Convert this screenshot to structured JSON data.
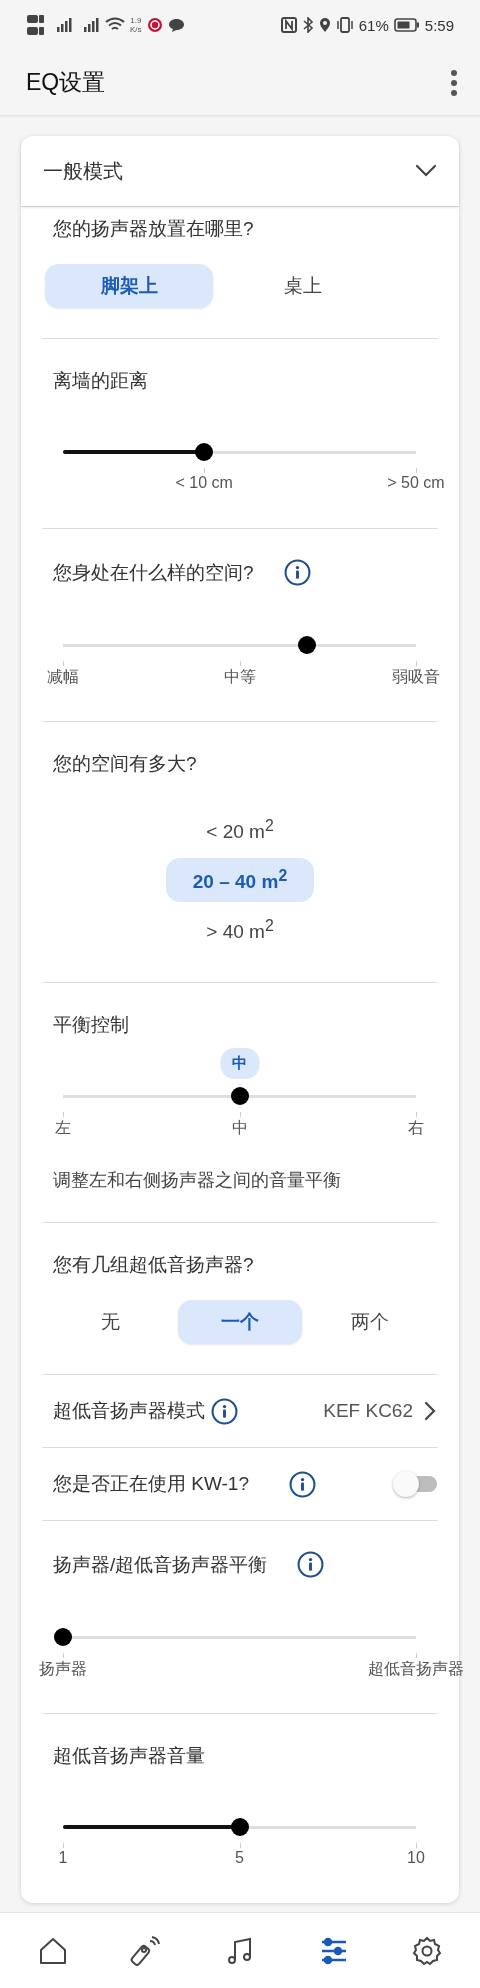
{
  "status_bar": {
    "speed_value": "1.9",
    "speed_unit": "K/s",
    "battery": "61%",
    "time": "5:59"
  },
  "app_bar": {
    "title": "EQ设置"
  },
  "mode": {
    "label": "一般模式"
  },
  "sections": [
    {
      "kind": "segmented",
      "title": "您的扬声器放置在哪里?",
      "options": [
        {
          "label": "脚架上",
          "selected": true
        },
        {
          "label": "桌上",
          "selected": false
        }
      ]
    },
    {
      "kind": "slider",
      "title": "离墙的距离",
      "info": false,
      "fill": true,
      "level": 0.4,
      "labels": [
        {
          "text": "< 10 cm",
          "under_thumb": true
        },
        {
          "text": "> 50 cm",
          "under_thumb": false
        }
      ]
    },
    {
      "kind": "slider",
      "title": "您身处在什么样的空间?",
      "info": true,
      "fill": false,
      "level": 0.69,
      "labels": [
        {
          "text": "减幅",
          "under_thumb": false
        },
        {
          "text": "中等",
          "under_thumb": false
        },
        {
          "text": "弱吸音",
          "under_thumb": false
        }
      ]
    },
    {
      "kind": "list",
      "title": "您的空间有多大?",
      "options": [
        {
          "label": "< 20 m$^{2}$",
          "selected": false
        },
        {
          "label": "20 – 40 m$^{2}$",
          "selected": true
        },
        {
          "label": "> 40 m$^{2}$",
          "selected": false
        }
      ]
    },
    {
      "kind": "slider",
      "title": "平衡控制",
      "info": false,
      "fill": false,
      "level": 0.5,
      "bubble": "中",
      "labels": [
        {
          "text": "左",
          "under_thumb": false
        },
        {
          "text": "中",
          "under_thumb": false
        },
        {
          "text": "右",
          "under_thumb": false
        }
      ],
      "description": "调整左和右侧扬声器之间的音量平衡"
    },
    {
      "kind": "segmented",
      "title": "您有几组超低音扬声器?",
      "options": [
        {
          "label": "无",
          "selected": false
        },
        {
          "label": "一个",
          "selected": true
        },
        {
          "label": "两个",
          "selected": false
        }
      ]
    },
    {
      "kind": "link",
      "title": "超低音扬声器模式",
      "info": true,
      "value": "KEF KC62"
    },
    {
      "kind": "switch",
      "title": "您是否正在使用 KW-1?",
      "info": true,
      "on": false
    },
    {
      "kind": "slider",
      "title": "扬声器/超低音扬声器平衡",
      "info": true,
      "fill": false,
      "level": 0,
      "labels": [
        {
          "text": "扬声器",
          "under_thumb": false
        },
        {
          "text": "超低音扬声器",
          "under_thumb": false
        }
      ]
    },
    {
      "kind": "slider",
      "title": "超低音扬声器音量",
      "info": false,
      "fill": true,
      "level": 0.5,
      "labels": [
        {
          "text": "1",
          "under_thumb": false
        },
        {
          "text": "5",
          "under_thumb": false
        },
        {
          "text": "10",
          "under_thumb": false
        }
      ]
    }
  ],
  "nav": [
    {
      "kind": "home",
      "selected": false
    },
    {
      "kind": "remote",
      "selected": false
    },
    {
      "kind": "music",
      "selected": false
    },
    {
      "kind": "equalizer",
      "selected": true
    },
    {
      "kind": "settings",
      "selected": false
    }
  ]
}
